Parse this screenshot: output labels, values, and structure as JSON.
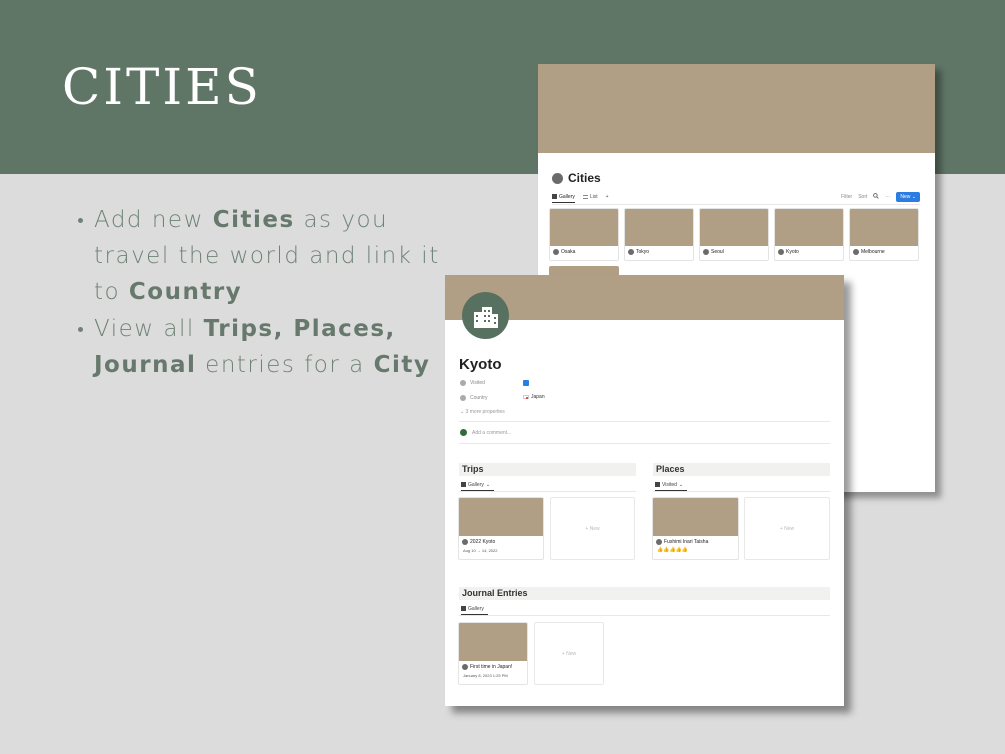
{
  "hero": {
    "title": "CITIES"
  },
  "bullets": [
    {
      "prefix": "Add new ",
      "bold1": "Cities",
      "mid": " as you travel the world and link it to ",
      "bold2": "Country"
    },
    {
      "prefix": "View all ",
      "bold1": "Trips, Places, Journal",
      "mid": " entries for a ",
      "bold2": "City"
    }
  ],
  "cities_db": {
    "title": "Cities",
    "tabs": [
      {
        "label": "Gallery"
      },
      {
        "label": "List"
      }
    ],
    "add_view": "+",
    "actions": {
      "filter": "Filter",
      "sort": "Sort",
      "more": "···",
      "new": "New",
      "caret": "⌄"
    },
    "cards": [
      {
        "name": "Osaka"
      },
      {
        "name": "Tokyo"
      },
      {
        "name": "Seoul"
      },
      {
        "name": "Kyoto"
      },
      {
        "name": "Melbourne"
      }
    ]
  },
  "kyoto_page": {
    "title": "Kyoto",
    "props": {
      "visited_label": "Visited",
      "country_label": "Country",
      "country_value": "Japan",
      "more_props": "3 more properties"
    },
    "comment_placeholder": "Add a comment...",
    "trips": {
      "title": "Trips",
      "view": "Gallery",
      "card": {
        "name": "2022 Kyoto",
        "dates": "Aug 10 → 14, 2022"
      },
      "new_label": "+ New"
    },
    "places": {
      "title": "Places",
      "view": "Visited",
      "card": {
        "name": "Fushimi Inari Taisha",
        "rating": "👍👍👍👍👍"
      },
      "new_label": "+ New"
    },
    "journal": {
      "title": "Journal Entries",
      "view": "Gallery",
      "card": {
        "name": "First time in Japan!",
        "date": "January 8, 2023 1:25 PM"
      },
      "new_label": "+ New"
    }
  },
  "colors": {
    "banner": "#5f7566",
    "cover": "#b19f85",
    "text_green": "#6f8275",
    "accent_blue": "#2b7de1"
  }
}
